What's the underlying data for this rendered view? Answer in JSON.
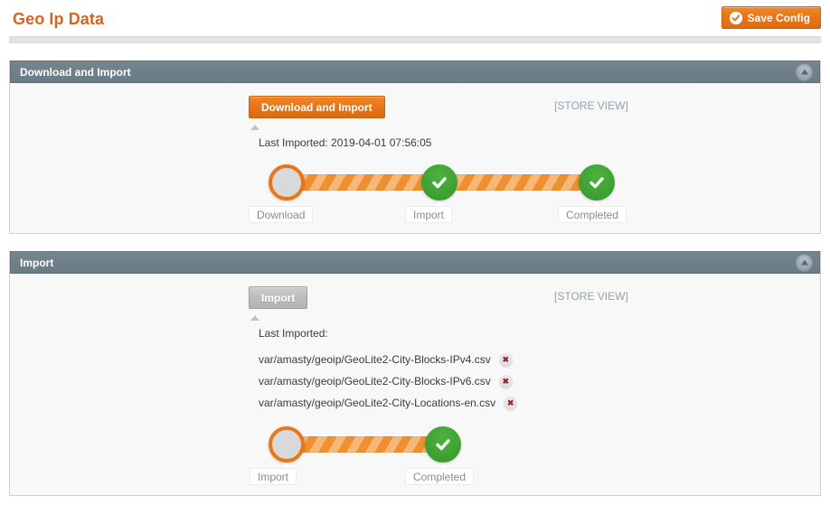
{
  "header": {
    "title": "Geo Ip Data",
    "save_button": {
      "label": "Save Config",
      "icon": "check-circle-icon"
    }
  },
  "colors": {
    "accent_orange": "#e8761a",
    "panel_header": "#6e7f88",
    "success_green": "#3d9e31",
    "store_view_text": "#90a3af",
    "delete_x": "#9b2626"
  },
  "sections": [
    {
      "id": "download-and-import",
      "title": "Download and Import",
      "collapse_icon": "chevron-up-icon",
      "action_button": {
        "label": "Download and Import",
        "style": "orange"
      },
      "scope_label": "[STORE VIEW]",
      "last_imported_label": "Last Imported: 2019-04-01 07:56:05",
      "files": [],
      "stepper": {
        "steps": [
          {
            "label": "Download",
            "state": "pending"
          },
          {
            "label": "Import",
            "state": "done"
          },
          {
            "label": "Completed",
            "state": "done"
          }
        ]
      }
    },
    {
      "id": "import",
      "title": "Import",
      "collapse_icon": "chevron-up-icon",
      "action_button": {
        "label": "Import",
        "style": "gray"
      },
      "scope_label": "[STORE VIEW]",
      "last_imported_label": "Last Imported:",
      "files": [
        {
          "path": "var/amasty/geoip/GeoLite2-City-Blocks-IPv4.csv",
          "delete_icon": "delete-x-icon"
        },
        {
          "path": "var/amasty/geoip/GeoLite2-City-Blocks-IPv6.csv",
          "delete_icon": "delete-x-icon"
        },
        {
          "path": "var/amasty/geoip/GeoLite2-City-Locations-en.csv",
          "delete_icon": "delete-x-icon"
        }
      ],
      "stepper": {
        "steps": [
          {
            "label": "Import",
            "state": "pending"
          },
          {
            "label": "Completed",
            "state": "done"
          }
        ]
      }
    }
  ]
}
